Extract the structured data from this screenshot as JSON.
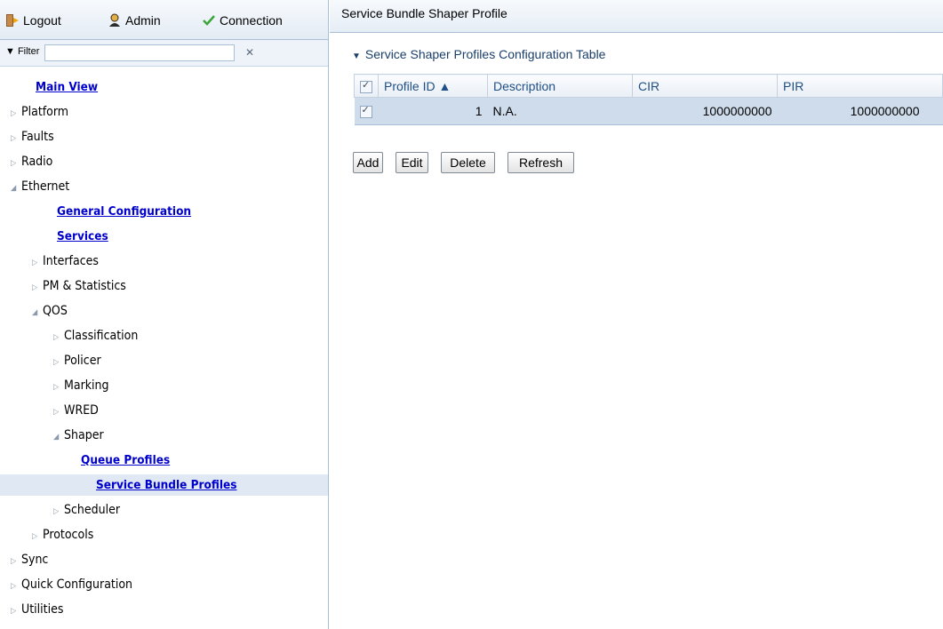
{
  "toolbar": {
    "logout_label": "Logout",
    "admin_label": "Admin",
    "connection_label": "Connection"
  },
  "filter": {
    "label": "▼ Filter",
    "value": "",
    "clear_label": "✕"
  },
  "nav": {
    "main_view": "Main View",
    "platform": "Platform",
    "faults": "Faults",
    "radio": "Radio",
    "ethernet": "Ethernet",
    "general_configuration": "General Configuration",
    "services": "Services",
    "interfaces": "Interfaces",
    "pm_statistics": "PM & Statistics",
    "qos": "QOS",
    "classification": "Classification",
    "policer": "Policer",
    "marking": "Marking",
    "wred": "WRED",
    "shaper": "Shaper",
    "queue_profiles": "Queue Profiles",
    "service_bundle_profiles": "Service Bundle Profiles",
    "scheduler": "Scheduler",
    "protocols": "Protocols",
    "sync": "Sync",
    "quick_configuration": "Quick Configuration",
    "utilities": "Utilities"
  },
  "page": {
    "title": "Service Bundle Shaper Profile",
    "section_title": "Service Shaper Profiles Configuration Table"
  },
  "table": {
    "headers": {
      "profile_id": "Profile ID ▲",
      "description": "Description",
      "cir": "CIR",
      "pir": "PIR"
    },
    "rows": [
      {
        "profile_id": "1",
        "description": "N.A.",
        "cir": "1000000000",
        "pir": "1000000000",
        "checked": true
      }
    ]
  },
  "buttons": {
    "add": "Add",
    "edit": "Edit",
    "delete": "Delete",
    "refresh": "Refresh"
  },
  "colors": {
    "selected_row": "#cfdcec",
    "header_text": "#1e4f86",
    "link": "#0000cc",
    "border": "#a9bfd6"
  }
}
